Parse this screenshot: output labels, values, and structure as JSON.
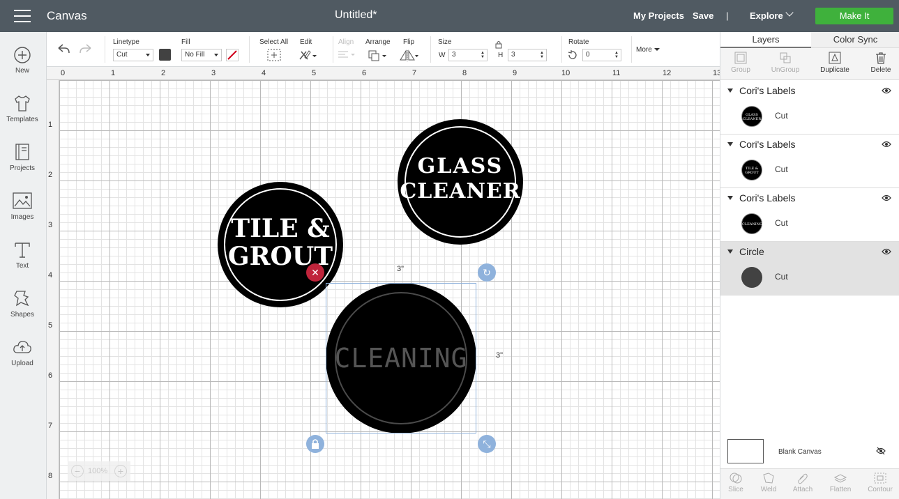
{
  "header": {
    "app_title": "Canvas",
    "doc_title": "Untitled*",
    "my_projects": "My Projects",
    "save": "Save",
    "divider": "|",
    "explore": "Explore",
    "make_it": "Make It",
    "make_it_color": "#3fb13c",
    "bar_color": "#505a62"
  },
  "sidebar": {
    "items": [
      {
        "label": "New",
        "icon": "plus-circle-icon"
      },
      {
        "label": "Templates",
        "icon": "tshirt-icon"
      },
      {
        "label": "Projects",
        "icon": "book-icon"
      },
      {
        "label": "Images",
        "icon": "image-icon"
      },
      {
        "label": "Text",
        "icon": "text-icon"
      },
      {
        "label": "Shapes",
        "icon": "shapes-icon"
      },
      {
        "label": "Upload",
        "icon": "upload-icon"
      }
    ]
  },
  "toolbar": {
    "linetype_label": "Linetype",
    "linetype_value": "Cut",
    "fill_label": "Fill",
    "fill_value": "No Fill",
    "select_all_label": "Select All",
    "edit_label": "Edit",
    "align_label": "Align",
    "arrange_label": "Arrange",
    "flip_label": "Flip",
    "size_label": "Size",
    "w_label": "W",
    "w_value": "3",
    "h_label": "H",
    "h_value": "3",
    "rotate_label": "Rotate",
    "rotate_value": "0",
    "more_label": "More",
    "linetype_color": "#424242",
    "fill_slash_color": "#d0021b"
  },
  "canvas": {
    "ruler_top": [
      "0",
      "1",
      "2",
      "3",
      "4",
      "5",
      "6",
      "7",
      "8",
      "9",
      "10",
      "11",
      "12",
      "13"
    ],
    "ruler_left": [
      "1",
      "2",
      "3",
      "4",
      "5",
      "6",
      "7",
      "8"
    ],
    "labels": [
      {
        "line1": "GLASS",
        "line2": "CLEANER"
      },
      {
        "line1": "TILE &",
        "line2": "GROUT"
      },
      {
        "line1": "CLEANING"
      }
    ],
    "width_dim": "3\"",
    "height_dim": "3\"",
    "zoom": "100%",
    "selection_color": "#8fb2dc",
    "delete_handle_color": "#c0243b"
  },
  "layers_panel": {
    "tabs": [
      "Layers",
      "Color Sync"
    ],
    "tools": [
      {
        "label": "Group",
        "icon": "group-icon"
      },
      {
        "label": "UnGroup",
        "icon": "ungroup-icon"
      },
      {
        "label": "Duplicate",
        "icon": "duplicate-icon"
      },
      {
        "label": "Delete",
        "icon": "trash-icon"
      }
    ],
    "layers": [
      {
        "name": "Cori's Labels",
        "op": "Cut",
        "thumb": "GLASS CLEANER"
      },
      {
        "name": "Cori's Labels",
        "op": "Cut",
        "thumb": "TILE & GROUT"
      },
      {
        "name": "Cori's Labels",
        "op": "Cut",
        "thumb": "CLEANING"
      },
      {
        "name": "Circle",
        "op": "Cut",
        "thumb": ""
      }
    ],
    "blank_canvas": "Blank Canvas",
    "bottom_tools": [
      "Slice",
      "Weld",
      "Attach",
      "Flatten",
      "Contour"
    ]
  }
}
